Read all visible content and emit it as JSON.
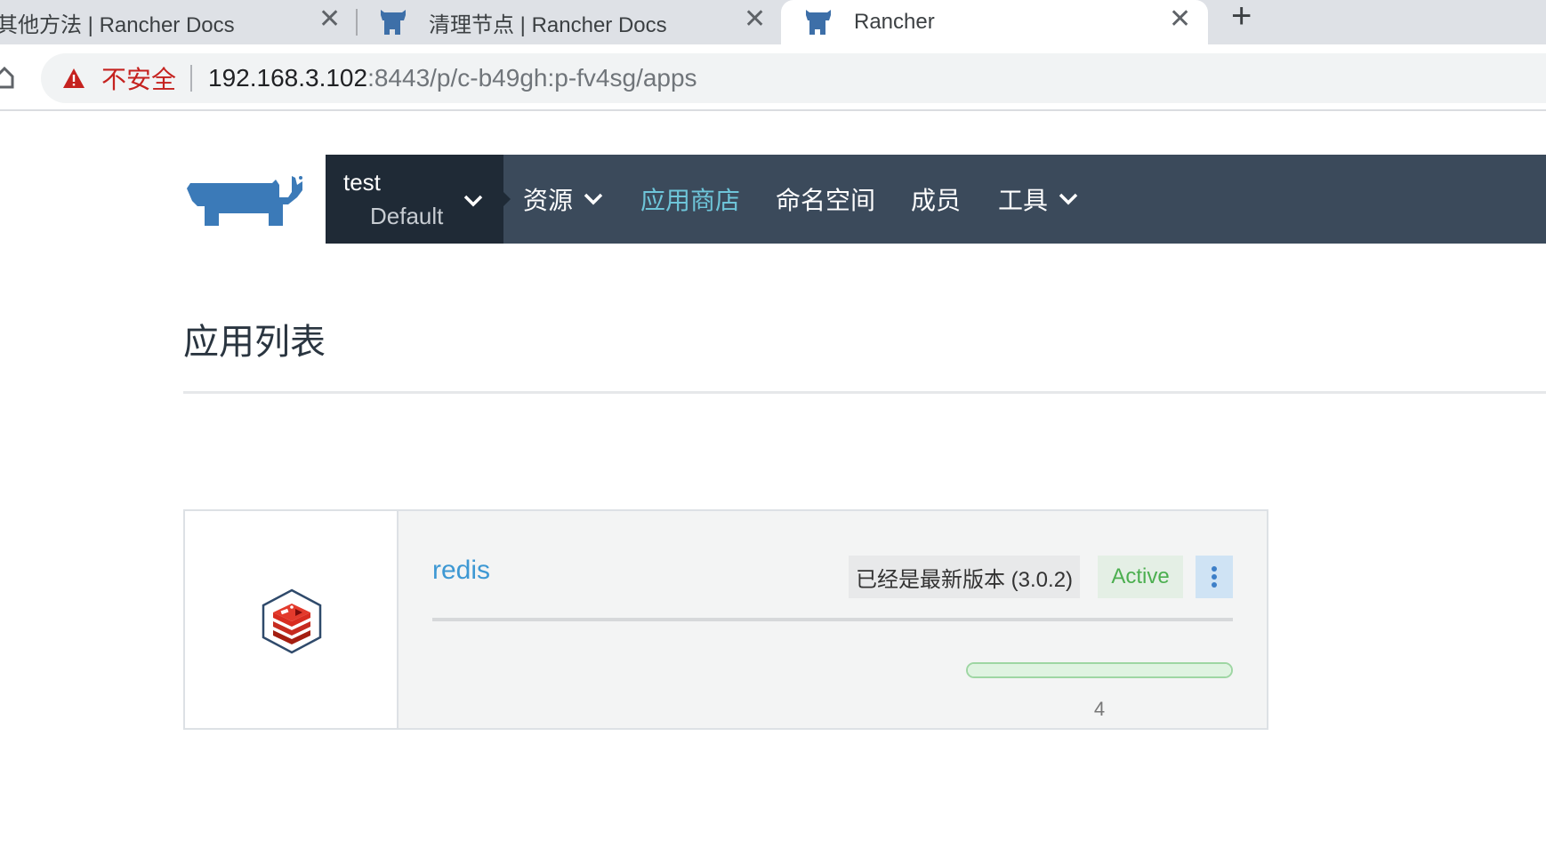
{
  "browser": {
    "tabs": [
      {
        "title": "其他方法 | Rancher Docs"
      },
      {
        "title": "清理节点 | Rancher Docs"
      },
      {
        "title": "Rancher",
        "active": true
      }
    ],
    "new_tab_label": "+",
    "close_glyph": "✕",
    "address": {
      "security_label": "不安全",
      "host": "192.168.3.102",
      "path": ":8443/p/c-b49gh:p-fv4sg/apps"
    }
  },
  "header": {
    "cluster": "test",
    "project": "Default",
    "nav": [
      {
        "label": "资源",
        "dropdown": true
      },
      {
        "label": "应用商店",
        "active": true
      },
      {
        "label": "命名空间"
      },
      {
        "label": "成员"
      },
      {
        "label": "工具",
        "dropdown": true
      }
    ]
  },
  "page": {
    "title": "应用列表"
  },
  "app": {
    "name": "redis",
    "version_text": "已经是最新版本 (3.0.2)",
    "status": "Active",
    "progress_fraction": 1.0,
    "count": "4",
    "icon": "redis-logo"
  },
  "colors": {
    "nav_bg": "#3b4a5b",
    "active_nav": "#6ec5d9",
    "link": "#3d98d3",
    "status_active": "#4caf50",
    "insecure": "#c5221f"
  }
}
